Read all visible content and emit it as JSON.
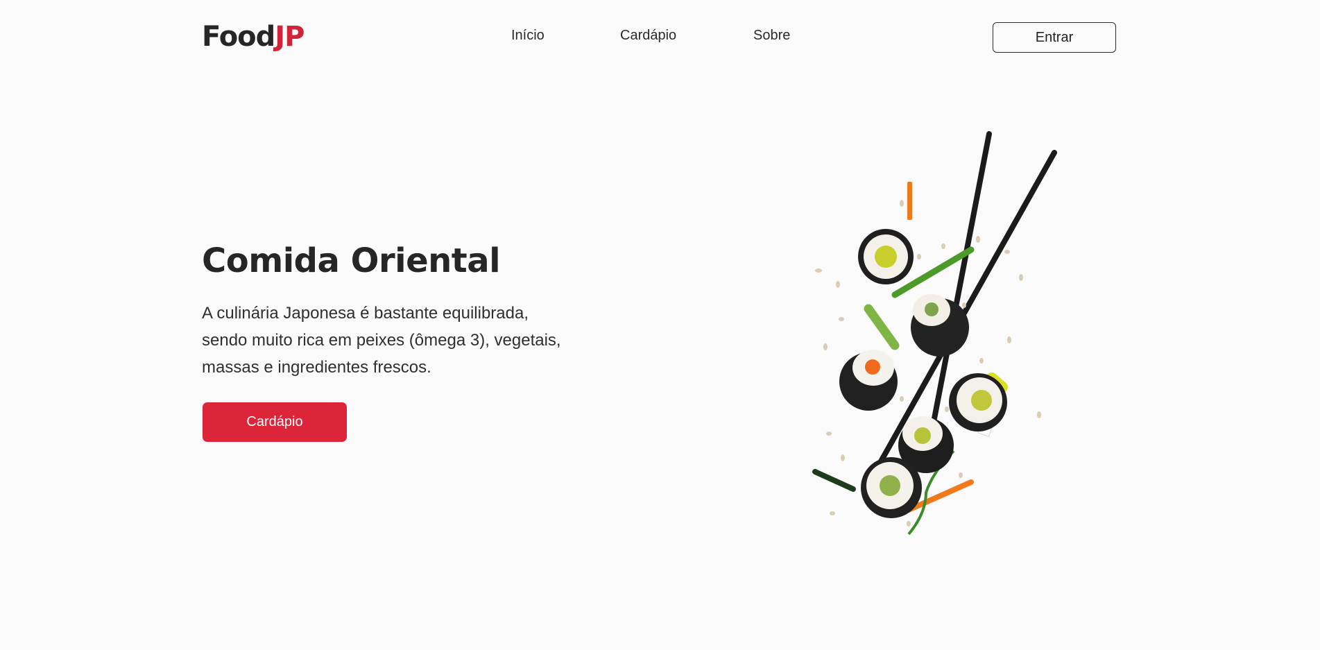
{
  "header": {
    "logo_main": "Food",
    "logo_accent": "JP",
    "nav": [
      {
        "label": "Início"
      },
      {
        "label": "Cardápio"
      },
      {
        "label": "Sobre"
      }
    ],
    "login_label": "Entrar"
  },
  "hero": {
    "title": "Comida Oriental",
    "description": "A culinária Japonesa é bastante equilibrada, sendo muito rica em peixes (ômega 3), vegetais, massas e ingredientes frescos.",
    "cta_label": "Cardápio",
    "image": "sushi-chopsticks-illustration"
  },
  "colors": {
    "accent": "#dc2539",
    "background": "#fafafa",
    "text": "#262626"
  }
}
